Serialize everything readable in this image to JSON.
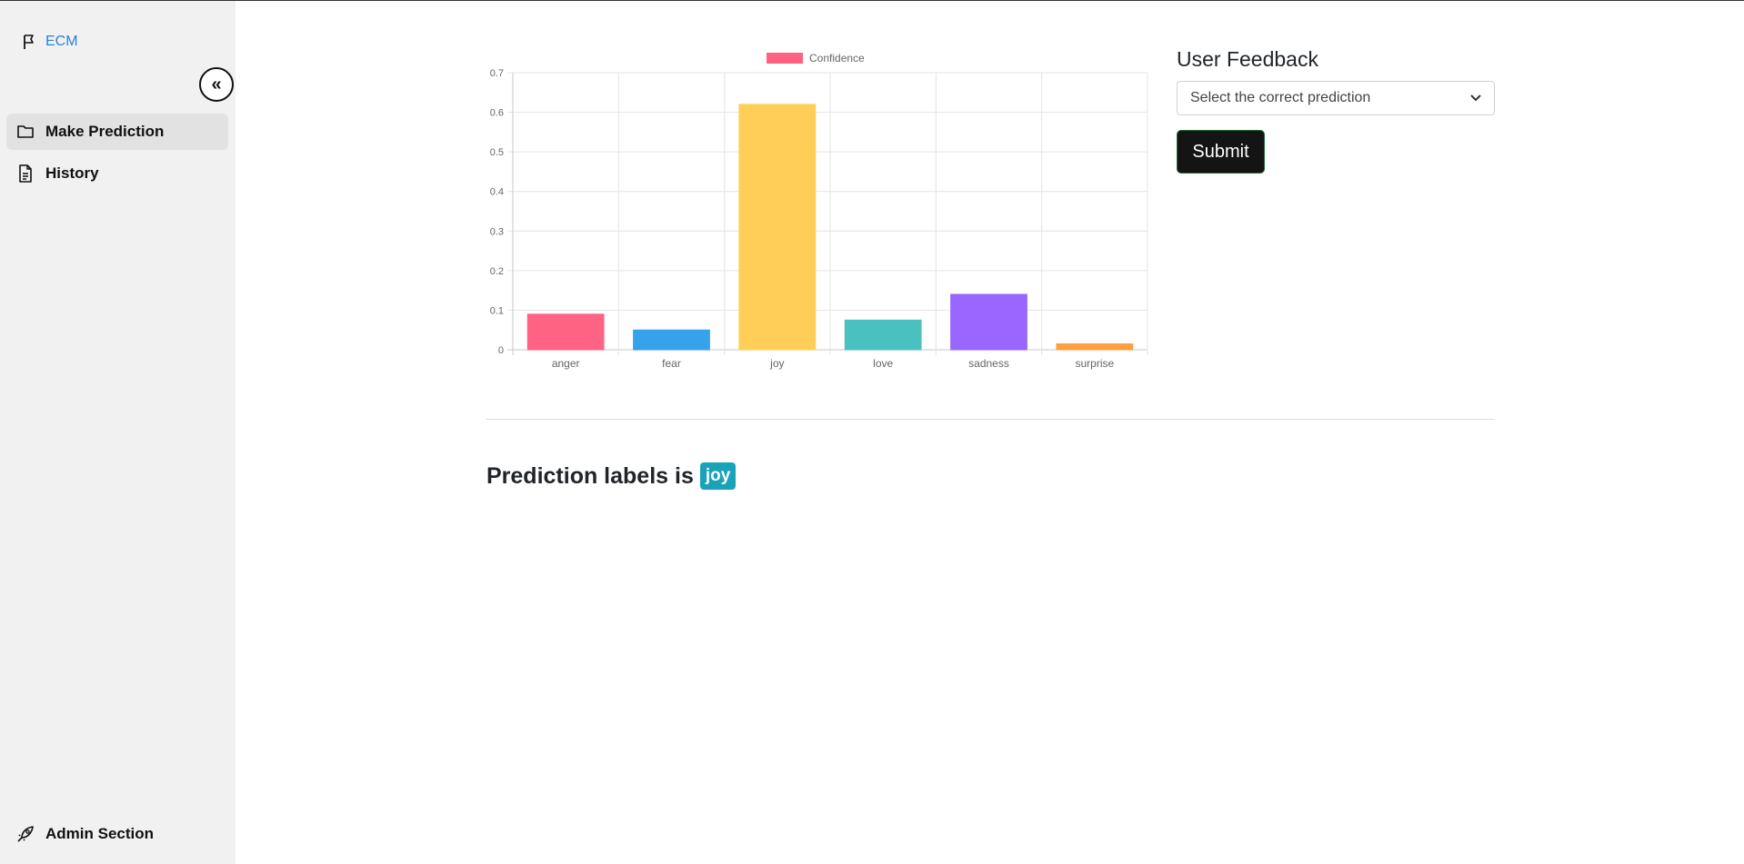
{
  "sidebar": {
    "brand": "ECM",
    "items": [
      {
        "label": "Make Prediction",
        "icon": "folder-icon",
        "active": true
      },
      {
        "label": "History",
        "icon": "document-icon",
        "active": false
      }
    ],
    "admin": {
      "label": "Admin Section",
      "icon": "rocket-icon"
    },
    "collapse_icon": "double-chevron-left-icon"
  },
  "chart_data": {
    "type": "bar",
    "categories": [
      "anger",
      "fear",
      "joy",
      "love",
      "sadness",
      "surprise"
    ],
    "series": [
      {
        "name": "Confidence",
        "values": [
          0.09,
          0.05,
          0.62,
          0.075,
          0.14,
          0.015
        ]
      }
    ],
    "colors": [
      "#ff6384",
      "#36a2eb",
      "#ffce56",
      "#4bc0c0",
      "#9966ff",
      "#ff9f40"
    ],
    "ylim": [
      0,
      0.7
    ],
    "yticks": [
      "0",
      "0.1",
      "0.2",
      "0.3",
      "0.4",
      "0.5",
      "0.6",
      "0.7"
    ],
    "grid": true,
    "legend": "top-center"
  },
  "feedback": {
    "title": "User Feedback",
    "select_placeholder": "Select the correct prediction",
    "submit_label": "Submit"
  },
  "prediction": {
    "text": "Prediction labels is",
    "label": "joy"
  }
}
